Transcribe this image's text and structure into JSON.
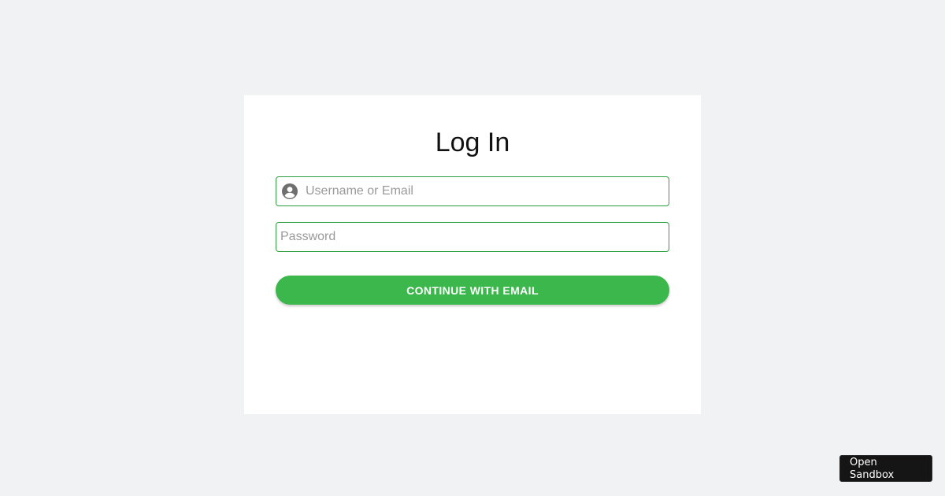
{
  "login": {
    "title": "Log In",
    "username_placeholder": "Username or Email",
    "username_value": "",
    "password_placeholder": "Password",
    "password_value": "",
    "submit_label": "CONTINUE WITH EMAIL"
  },
  "sandbox": {
    "label": "Open Sandbox"
  },
  "icons": {
    "username": "account-circle-icon"
  },
  "colors": {
    "background": "#f0f2f4",
    "card": "#ffffff",
    "accent": "#3bb74c",
    "field_border": "#2e9e3f",
    "sandbox_bg": "#151515"
  }
}
